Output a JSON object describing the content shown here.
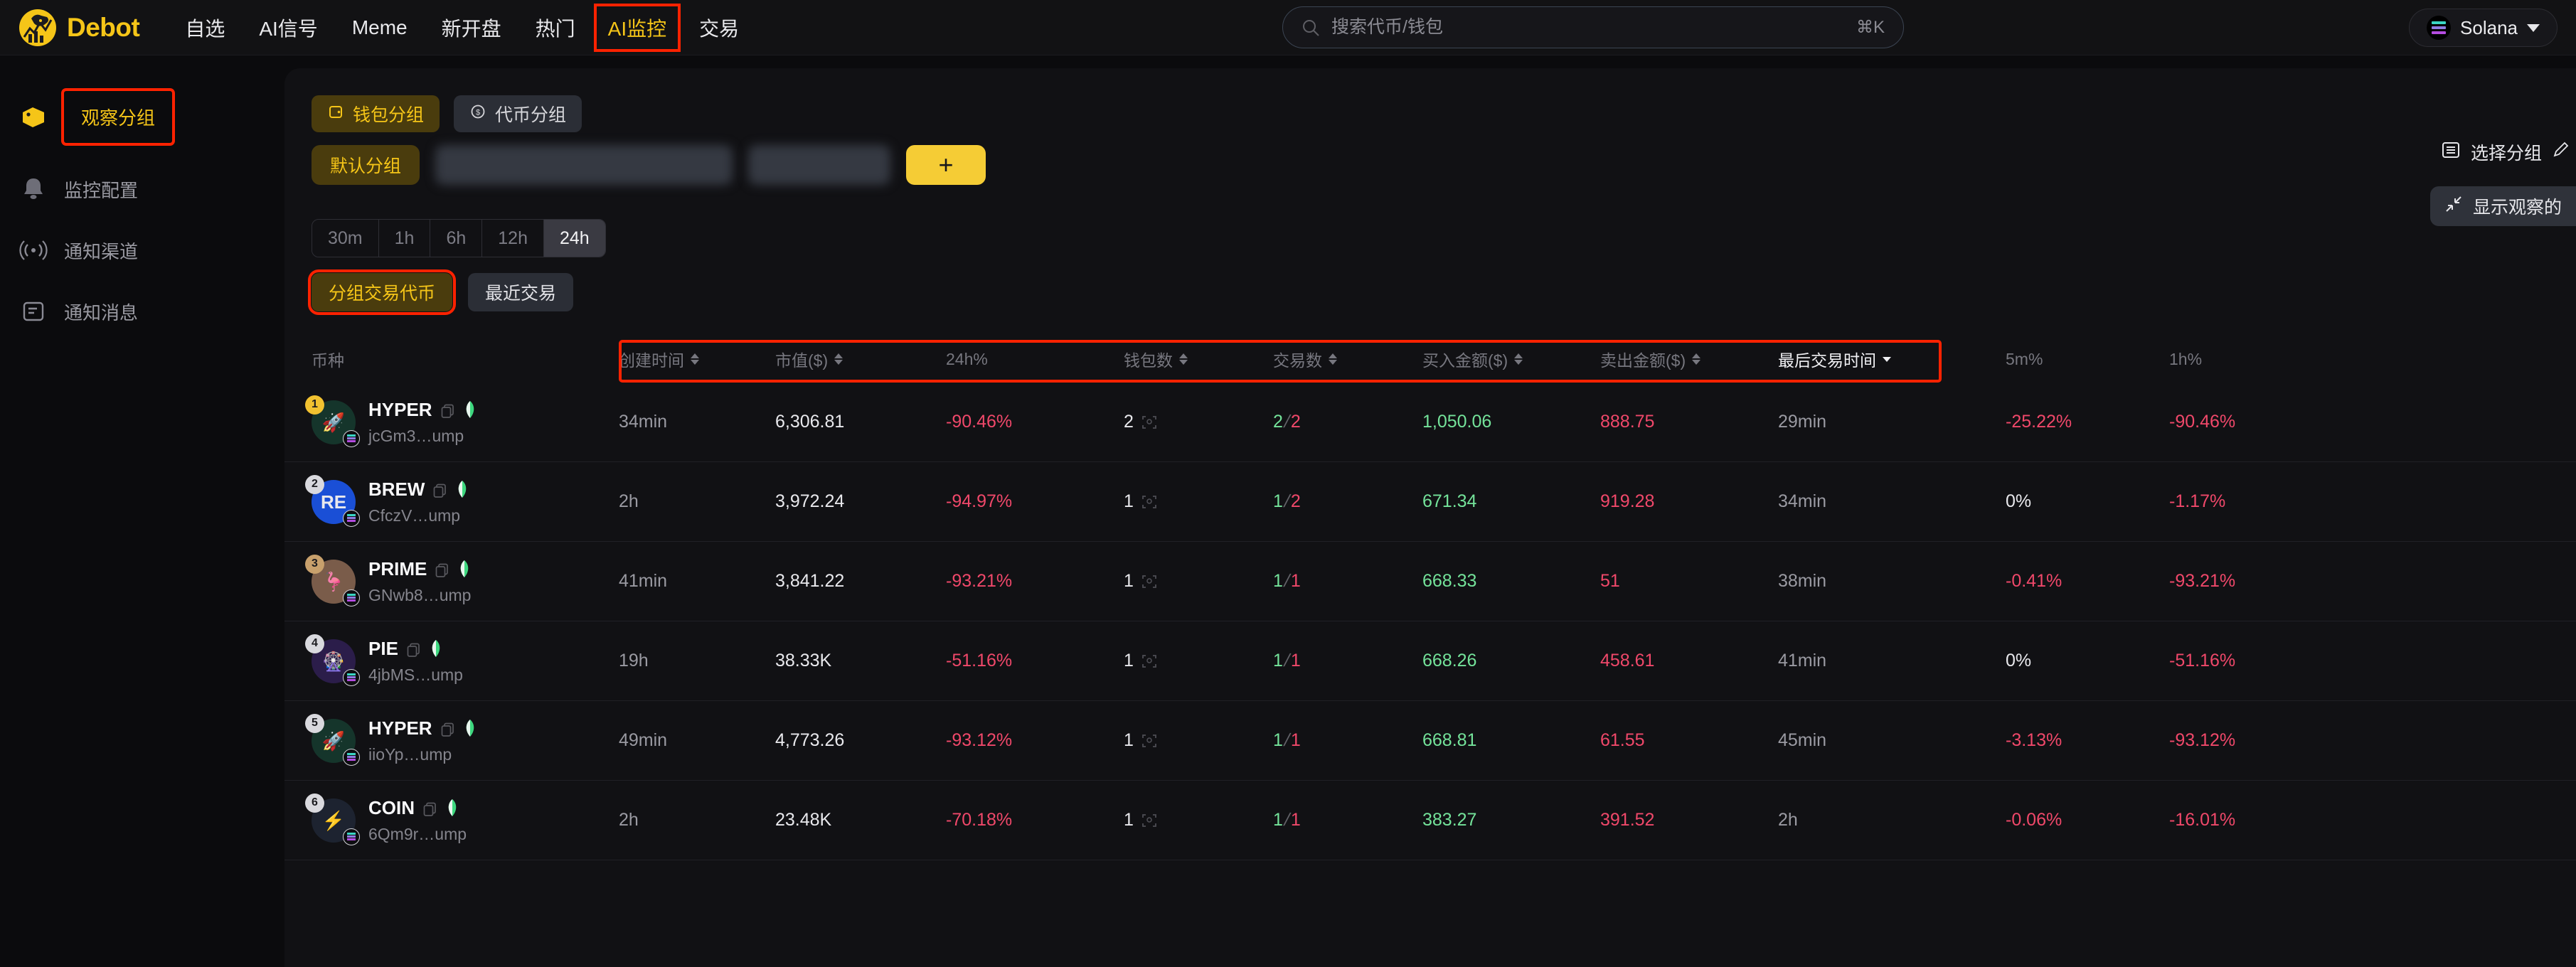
{
  "brand": {
    "name": "Debot",
    "logo_icon": "debot-dog-logo"
  },
  "nav": {
    "items": [
      {
        "label": "自选",
        "active": false
      },
      {
        "label": "AI信号",
        "active": false
      },
      {
        "label": "Meme",
        "active": false
      },
      {
        "label": "新开盘",
        "active": false
      },
      {
        "label": "热门",
        "active": false
      },
      {
        "label": "AI监控",
        "active": true,
        "highlighted": true
      },
      {
        "label": "交易",
        "active": false
      }
    ]
  },
  "search": {
    "placeholder": "搜索代币/钱包",
    "value": "",
    "shortcut": "⌘K",
    "icon": "search-icon"
  },
  "chain_select": {
    "label": "Solana",
    "icon": "solana-icon",
    "caret": "chevron-down-icon"
  },
  "sidebar": {
    "items": [
      {
        "label": "观察分组",
        "icon": "tag-icon",
        "active": true,
        "highlighted": true
      },
      {
        "label": "监控配置",
        "icon": "bell-icon",
        "active": false
      },
      {
        "label": "通知渠道",
        "icon": "broadcast-icon",
        "active": false
      },
      {
        "label": "通知消息",
        "icon": "message-list-icon",
        "active": false
      }
    ]
  },
  "seg_tabs": [
    {
      "label": "钱包分组",
      "icon": "wallet-icon",
      "active": true
    },
    {
      "label": "代币分组",
      "icon": "coin-dollar-icon",
      "active": false
    }
  ],
  "groups": {
    "chips": [
      {
        "label": "默认分组",
        "active": true,
        "blurred": false
      },
      {
        "label": "",
        "active": false,
        "blurred": true,
        "wide": true
      },
      {
        "label": "",
        "active": false,
        "blurred": true,
        "wide": false
      }
    ],
    "add_label": "+"
  },
  "time_tabs": [
    {
      "label": "30m",
      "active": false
    },
    {
      "label": "1h",
      "active": false
    },
    {
      "label": "6h",
      "active": false
    },
    {
      "label": "12h",
      "active": false
    },
    {
      "label": "24h",
      "active": true
    }
  ],
  "sub_tabs": [
    {
      "label": "分组交易代币",
      "active": true,
      "highlighted": true
    },
    {
      "label": "最近交易",
      "active": false
    }
  ],
  "panel_right": {
    "select_group_label": "选择分组",
    "select_group_icon": "list-icon",
    "edit_icon": "pencil-icon",
    "show_watch_label": "显示观察的",
    "show_watch_icon": "collapse-arrows-icon"
  },
  "table": {
    "columns": [
      {
        "label": "币种",
        "sortable": false,
        "active": false
      },
      {
        "label": "创建时间",
        "sortable": true,
        "active": false
      },
      {
        "label": "市值($)",
        "sortable": true,
        "active": false
      },
      {
        "label": "24h%",
        "sortable": false,
        "active": false
      },
      {
        "label": "钱包数",
        "sortable": true,
        "active": false
      },
      {
        "label": "交易数",
        "sortable": true,
        "active": false
      },
      {
        "label": "买入金额($)",
        "sortable": true,
        "active": false
      },
      {
        "label": "卖出金额($)",
        "sortable": true,
        "active": false
      },
      {
        "label": "最后交易时间",
        "sortable": true,
        "active": true
      },
      {
        "label": "5m%",
        "sortable": false,
        "active": false
      },
      {
        "label": "1h%",
        "sortable": false,
        "active": false
      }
    ],
    "rows": [
      {
        "rank": "1",
        "rank_style": "gold",
        "symbol": "HYPER",
        "address": "jcGm3…ump",
        "avatar_bg": "#15352b",
        "avatar_glyph": "🚀",
        "created": "34min",
        "market_cap": "6,306.81",
        "change_24h": "-90.46%",
        "wallets": "2",
        "trades_buy": "2",
        "trades_sell": "2",
        "buy_amount": "1,050.06",
        "sell_amount": "888.75",
        "last_trade": "29min",
        "change_5m": "-25.22%",
        "change_1h": "-90.46%"
      },
      {
        "rank": "2",
        "rank_style": "plain",
        "symbol": "BREW",
        "address": "CfczV…ump",
        "avatar_bg": "#1a4fd6",
        "avatar_glyph": "RE",
        "created": "2h",
        "market_cap": "3,972.24",
        "change_24h": "-94.97%",
        "wallets": "1",
        "trades_buy": "1",
        "trades_sell": "2",
        "buy_amount": "671.34",
        "sell_amount": "919.28",
        "last_trade": "34min",
        "change_5m": "0%",
        "change_1h": "-1.17%"
      },
      {
        "rank": "3",
        "rank_style": "tan",
        "symbol": "PRIME",
        "address": "GNwb8…ump",
        "avatar_bg": "#7a5c4a",
        "avatar_glyph": "🦩",
        "created": "41min",
        "market_cap": "3,841.22",
        "change_24h": "-93.21%",
        "wallets": "1",
        "trades_buy": "1",
        "trades_sell": "1",
        "buy_amount": "668.33",
        "sell_amount": "51",
        "last_trade": "38min",
        "change_5m": "-0.41%",
        "change_1h": "-93.21%"
      },
      {
        "rank": "4",
        "rank_style": "plain",
        "symbol": "PIE",
        "address": "4jbMS…ump",
        "avatar_bg": "#2b1d4a",
        "avatar_glyph": "🎡",
        "created": "19h",
        "market_cap": "38.33K",
        "change_24h": "-51.16%",
        "wallets": "1",
        "trades_buy": "1",
        "trades_sell": "1",
        "buy_amount": "668.26",
        "sell_amount": "458.61",
        "last_trade": "41min",
        "change_5m": "0%",
        "change_1h": "-51.16%"
      },
      {
        "rank": "5",
        "rank_style": "plain",
        "symbol": "HYPER",
        "address": "iioYp…ump",
        "avatar_bg": "#15352b",
        "avatar_glyph": "🚀",
        "created": "49min",
        "market_cap": "4,773.26",
        "change_24h": "-93.12%",
        "wallets": "1",
        "trades_buy": "1",
        "trades_sell": "1",
        "buy_amount": "668.81",
        "sell_amount": "61.55",
        "last_trade": "45min",
        "change_5m": "-3.13%",
        "change_1h": "-93.12%"
      },
      {
        "rank": "6",
        "rank_style": "plain",
        "symbol": "COIN",
        "address": "6Qm9r…ump",
        "avatar_bg": "#1d2330",
        "avatar_glyph": "⚡",
        "created": "2h",
        "market_cap": "23.48K",
        "change_24h": "-70.18%",
        "wallets": "1",
        "trades_buy": "1",
        "trades_sell": "1",
        "buy_amount": "383.27",
        "sell_amount": "391.52",
        "last_trade": "2h",
        "change_5m": "-0.06%",
        "change_1h": "-16.01%"
      }
    ]
  },
  "colors": {
    "accent": "#f5c518",
    "up": "#74e39a",
    "down": "#f0486a",
    "highlight_box": "#ff2200",
    "bg": "#0b0b0d",
    "panel": "#111114"
  }
}
